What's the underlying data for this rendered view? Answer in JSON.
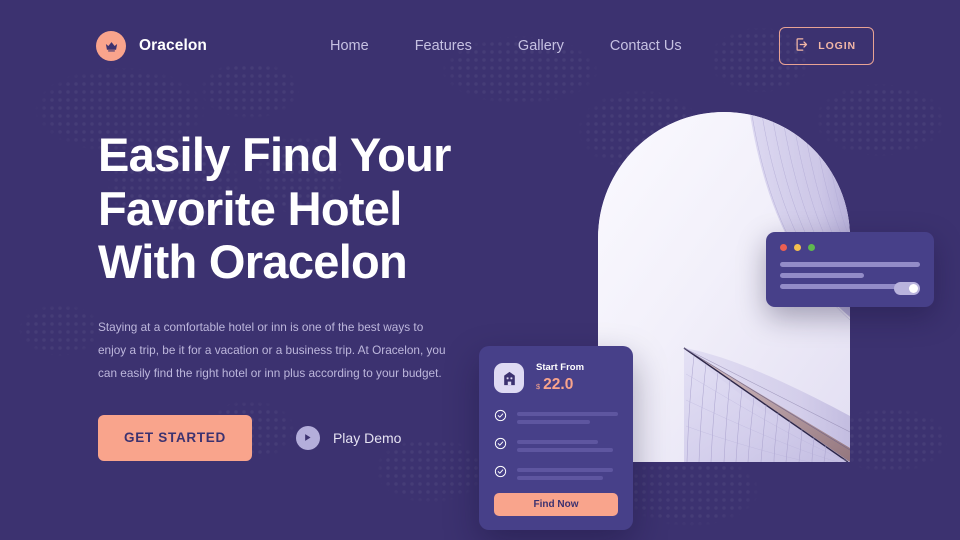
{
  "theme": {
    "background": "#3c3270",
    "accent": "#f9a48c",
    "card_bg": "#474089",
    "nav_link": "#c6c1e2",
    "heading": "#ffffff"
  },
  "nav": {
    "brand": {
      "name": "Oracelon",
      "icon": "crown-icon"
    },
    "links": [
      {
        "label": "Home"
      },
      {
        "label": "Features"
      },
      {
        "label": "Gallery"
      },
      {
        "label": "Contact Us"
      }
    ],
    "login": {
      "label": "LOGIN",
      "icon": "login-icon"
    }
  },
  "hero": {
    "heading_line1": "Easily Find Your",
    "heading_line2": "Favorite Hotel",
    "heading_line3": "With Oracelon",
    "paragraph": "Staying at a comfortable hotel or inn is one of the best ways to enjoy a trip, be it for a vacation or a business trip. At Oracelon, you can easily find the right hotel or inn plus according to your budget.",
    "primary_cta": "GET STARTED",
    "secondary_cta": "Play Demo",
    "secondary_icon": "play-icon"
  },
  "window_card": {
    "traffic_lights": [
      {
        "name": "close-dot",
        "color": "#ec5f52"
      },
      {
        "name": "minimize-dot",
        "color": "#f4bf4f"
      },
      {
        "name": "maximize-dot",
        "color": "#5fb84f"
      }
    ],
    "lines": [
      {
        "width": "100%"
      },
      {
        "width": "60%"
      },
      {
        "width": "85%"
      }
    ],
    "toggle_state": "on"
  },
  "price_card": {
    "icon": "hotel-icon",
    "label": "Start From",
    "currency": "$",
    "amount": "22.0",
    "items": [
      {
        "icon": "check-circle-icon",
        "bars": [
          "100%",
          "72%"
        ]
      },
      {
        "icon": "check-circle-icon",
        "bars": [
          "80%",
          "95%"
        ]
      },
      {
        "icon": "check-circle-icon",
        "bars": [
          "95%",
          "85%"
        ]
      }
    ],
    "button_label": "Find Now"
  }
}
